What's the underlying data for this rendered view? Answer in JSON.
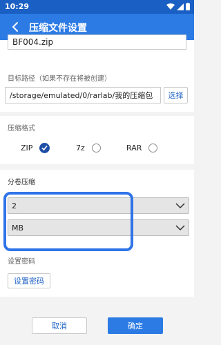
{
  "status_bar": {
    "time": "10:29",
    "icons": [
      "notification-icon",
      "wifi-icon",
      "signal-icon",
      "battery-icon"
    ]
  },
  "app_bar": {
    "title": "压缩文件设置",
    "back_icon": "back-arrow-icon"
  },
  "file_name": {
    "value": "BF004.zip"
  },
  "target_path": {
    "label": "目标路径（如果不存在将被创建）",
    "value": "/storage/emulated/0/rarlab/我的压缩包",
    "choose_button": "选择"
  },
  "format": {
    "label": "压缩格式",
    "options": [
      {
        "label": "ZIP",
        "checked": true
      },
      {
        "label": "7z",
        "checked": false
      },
      {
        "label": "RAR",
        "checked": false
      }
    ]
  },
  "volume": {
    "label": "分卷压缩",
    "size_value": "2",
    "unit_value": "MB"
  },
  "password": {
    "label": "设置密码",
    "button": "设置密码"
  },
  "actions": {
    "cancel": "取消",
    "ok": "确定"
  },
  "colors": {
    "app_bar": "#2c7be5",
    "status_bar": "#1a5fc3",
    "highlight": "#2f74e8",
    "accent": "#1f4ea8"
  }
}
